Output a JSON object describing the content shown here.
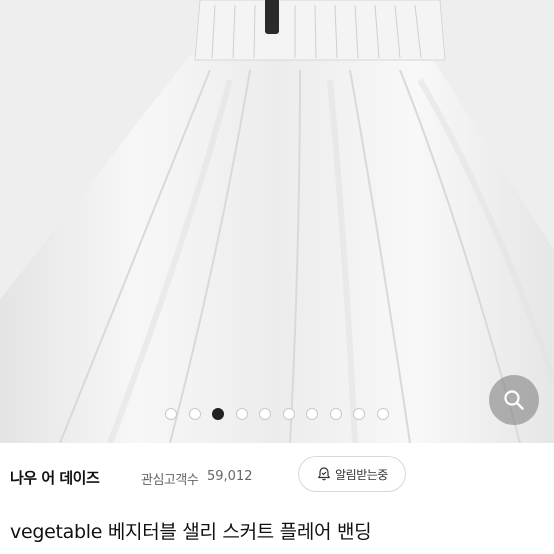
{
  "product_image": {
    "alt": "white flared banding skirt photo"
  },
  "carousel": {
    "total": 10,
    "active_index": 2
  },
  "zoom": {
    "icon": "search-icon"
  },
  "store": {
    "name": "나우 어 데이즈",
    "followers_label": "관심고객수",
    "followers_count": "59,012",
    "alarm_label": "알림받는중",
    "alarm_icon": "bell-check-icon"
  },
  "product": {
    "title": "vegetable 베지터블 샐리 스커트 플레어 밴딩"
  },
  "colors": {
    "dot_active": "#222222",
    "dot_inactive": "#ffffff"
  }
}
